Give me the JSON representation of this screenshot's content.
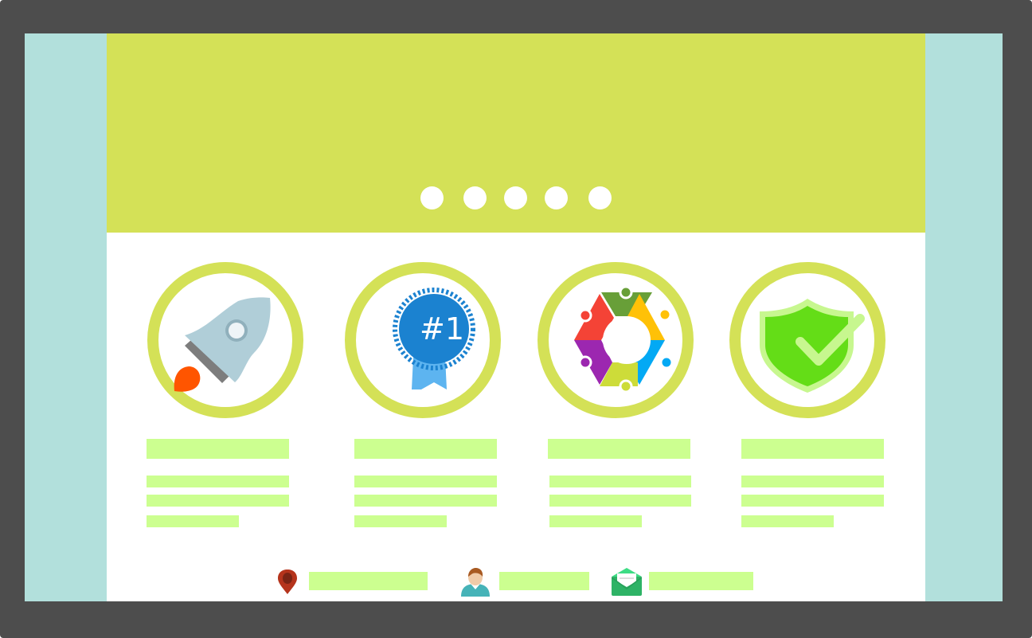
{
  "hero": {
    "slide_count": 5,
    "colors": {
      "banner": "#d4e157",
      "side": "#b2e0dc",
      "frame": "#4d4d4d",
      "placeholder": "#ccff90"
    }
  },
  "features": [
    {
      "icon": "rocket-icon"
    },
    {
      "icon": "award-ribbon-icon",
      "badge_text": "#1"
    },
    {
      "icon": "team-hexagon-icon"
    },
    {
      "icon": "shield-check-icon"
    }
  ],
  "footer": [
    {
      "icon": "location-pin-icon"
    },
    {
      "icon": "user-icon"
    },
    {
      "icon": "envelope-icon"
    }
  ]
}
